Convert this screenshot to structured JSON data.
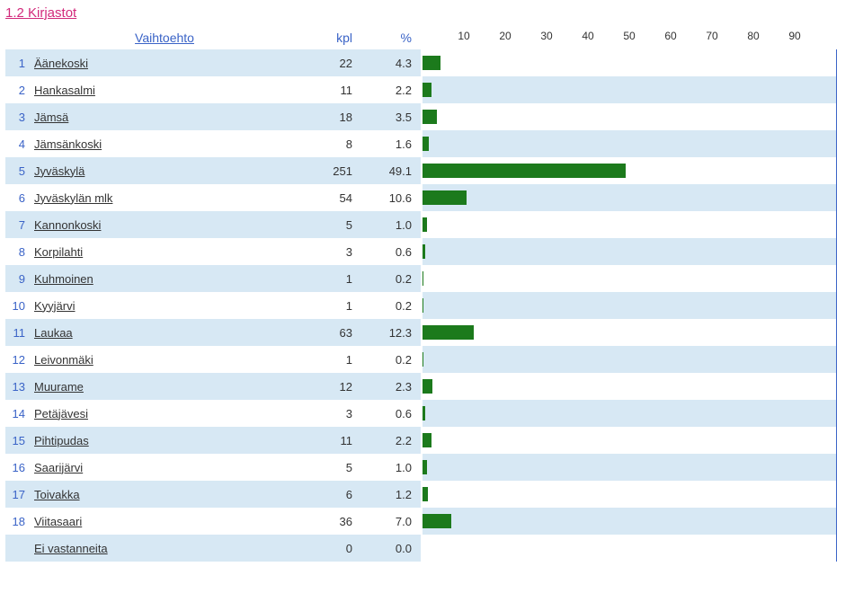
{
  "title": "1.2 Kirjastot",
  "header": {
    "name": "Vaihtoehto",
    "kpl": "kpl",
    "pct": "%"
  },
  "rows": [
    {
      "idx": "1",
      "name": "Äänekoski",
      "kpl": "22",
      "pct": "4.3"
    },
    {
      "idx": "2",
      "name": "Hankasalmi",
      "kpl": "11",
      "pct": "2.2"
    },
    {
      "idx": "3",
      "name": "Jämsä",
      "kpl": "18",
      "pct": "3.5"
    },
    {
      "idx": "4",
      "name": "Jämsänkoski",
      "kpl": "8",
      "pct": "1.6"
    },
    {
      "idx": "5",
      "name": "Jyväskylä",
      "kpl": "251",
      "pct": "49.1"
    },
    {
      "idx": "6",
      "name": "Jyväskylän mlk",
      "kpl": "54",
      "pct": "10.6"
    },
    {
      "idx": "7",
      "name": "Kannonkoski",
      "kpl": "5",
      "pct": "1.0"
    },
    {
      "idx": "8",
      "name": "Korpilahti",
      "kpl": "3",
      "pct": "0.6"
    },
    {
      "idx": "9",
      "name": "Kuhmoinen",
      "kpl": "1",
      "pct": "0.2"
    },
    {
      "idx": "10",
      "name": "Kyyjärvi",
      "kpl": "1",
      "pct": "0.2"
    },
    {
      "idx": "11",
      "name": "Laukaa",
      "kpl": "63",
      "pct": "12.3"
    },
    {
      "idx": "12",
      "name": "Leivonmäki",
      "kpl": "1",
      "pct": "0.2"
    },
    {
      "idx": "13",
      "name": "Muurame",
      "kpl": "12",
      "pct": "2.3"
    },
    {
      "idx": "14",
      "name": "Petäjävesi",
      "kpl": "3",
      "pct": "0.6"
    },
    {
      "idx": "15",
      "name": "Pihtipudas",
      "kpl": "11",
      "pct": "2.2"
    },
    {
      "idx": "16",
      "name": "Saarijärvi",
      "kpl": "5",
      "pct": "1.0"
    },
    {
      "idx": "17",
      "name": "Toivakka",
      "kpl": "6",
      "pct": "1.2"
    },
    {
      "idx": "18",
      "name": "Viitasaari",
      "kpl": "36",
      "pct": "7.0"
    },
    {
      "idx": "",
      "name": "Ei vastanneita",
      "kpl": "0",
      "pct": "0.0"
    }
  ],
  "axis_ticks": [
    "10",
    "20",
    "30",
    "40",
    "50",
    "60",
    "70",
    "80",
    "90"
  ],
  "chart_data": {
    "type": "bar",
    "title": "1.2 Kirjastot",
    "xlabel": "%",
    "ylabel": "Vaihtoehto",
    "xlim": [
      0,
      100
    ],
    "categories": [
      "Äänekoski",
      "Hankasalmi",
      "Jämsä",
      "Jämsänkoski",
      "Jyväskylä",
      "Jyväskylän mlk",
      "Kannonkoski",
      "Korpilahti",
      "Kuhmoinen",
      "Kyyjärvi",
      "Laukaa",
      "Leivonmäki",
      "Muurame",
      "Petäjävesi",
      "Pihtipudas",
      "Saarijärvi",
      "Toivakka",
      "Viitasaari",
      "Ei vastanneita"
    ],
    "series": [
      {
        "name": "kpl",
        "values": [
          22,
          11,
          18,
          8,
          251,
          54,
          5,
          3,
          1,
          1,
          63,
          1,
          12,
          3,
          11,
          5,
          6,
          36,
          0
        ]
      },
      {
        "name": "%",
        "values": [
          4.3,
          2.2,
          3.5,
          1.6,
          49.1,
          10.6,
          1.0,
          0.6,
          0.2,
          0.2,
          12.3,
          0.2,
          2.3,
          0.6,
          2.2,
          1.0,
          1.2,
          7.0,
          0.0
        ]
      }
    ]
  }
}
